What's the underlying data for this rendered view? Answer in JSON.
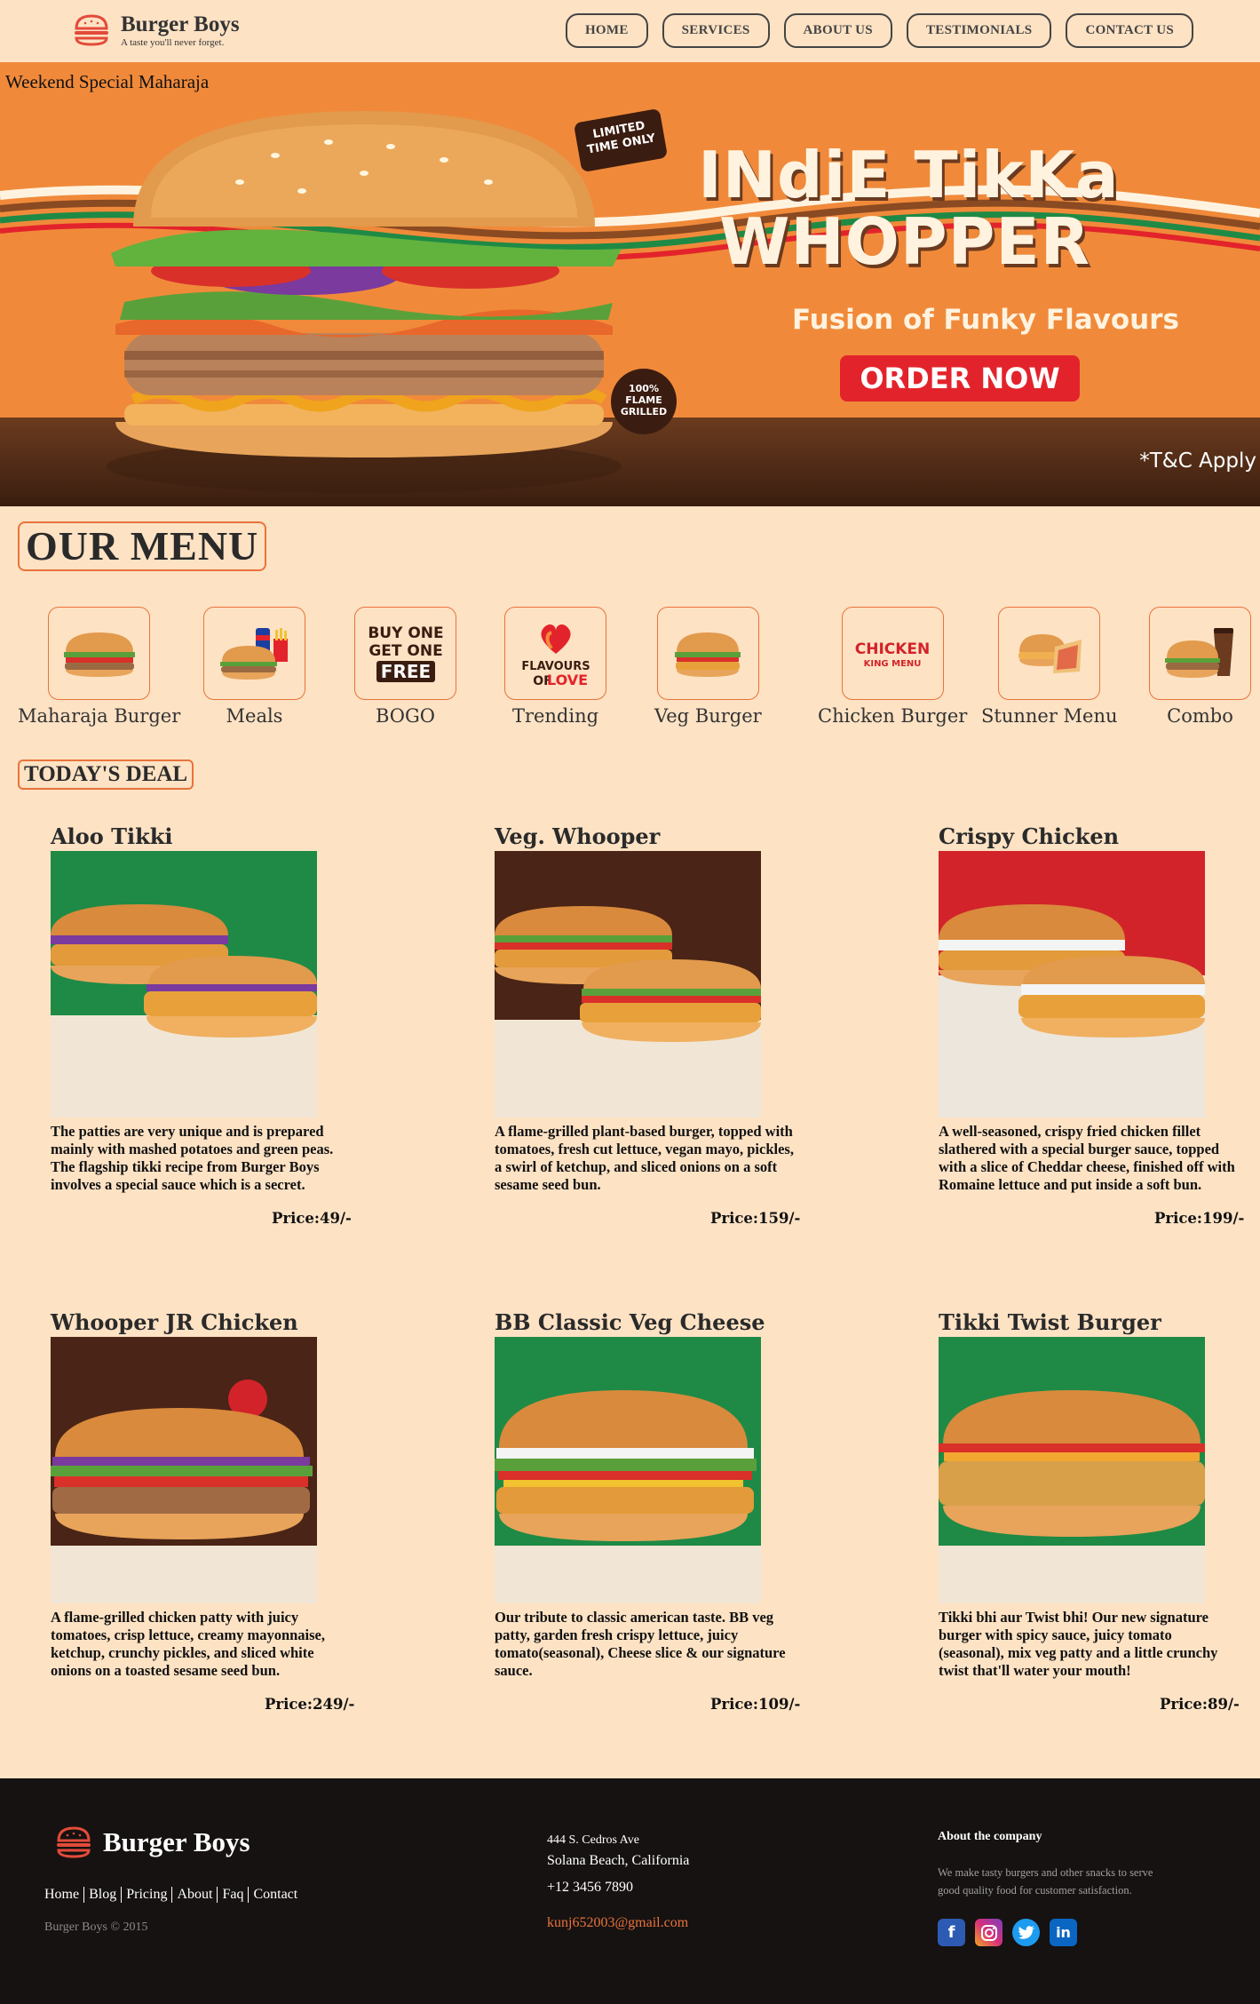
{
  "brand": {
    "name": "Burger Boys",
    "tagline": "A taste you'll never forget."
  },
  "nav": [
    "HOME",
    "SERVICES",
    "ABOUT US",
    "TESTIMONIALS",
    "CONTACT US"
  ],
  "hero": {
    "caption": "Weekend Special Maharaja",
    "limited": "LIMITED TIME ONLY",
    "title_line1": "INdiE TikKa",
    "title_line2": "WHOPPER",
    "subtitle": "Fusion of Funky Flavours",
    "cta": "ORDER NOW",
    "flame_badge": "100% FLAME GRILLED",
    "tc": "*T&C Apply"
  },
  "menu": {
    "title": "OUR MENU",
    "categories": [
      {
        "label": "Maharaja Burger",
        "icon": "burger-icon"
      },
      {
        "label": "Meals",
        "icon": "meal-icon"
      },
      {
        "label": "BOGO",
        "icon": "bogo-icon",
        "badge": "BUY ONE GET ONE FREE"
      },
      {
        "label": "Trending",
        "icon": "heart-icon",
        "badge": "FLAVOURS OF LOVE"
      },
      {
        "label": "Veg Burger",
        "icon": "burger-icon"
      },
      {
        "label": "Chicken Burger",
        "icon": "chicken-king-icon",
        "badge": "CHICKEN KING MENU"
      },
      {
        "label": "Stunner Menu",
        "icon": "wrap-icon"
      },
      {
        "label": "Combo",
        "icon": "combo-icon"
      }
    ]
  },
  "deals": {
    "title": "TODAY'S DEAL",
    "items": [
      {
        "name": "Aloo Tikki",
        "desc": "The patties are very unique and is prepared mainly with mashed potatoes and green peas. The flagship tikki recipe from Burger Boys involves a special sauce which is a secret.",
        "price": "Price:49/-",
        "bg": "#1e8a46",
        "style": "double"
      },
      {
        "name": "Veg. Whooper",
        "desc": "A flame-grilled plant-based burger, topped with tomatoes, fresh cut lettuce, vegan mayo, pickles, a swirl of ketchup, and sliced onions on a soft sesame seed bun.",
        "price": "Price:159/-",
        "bg": "#4a2416",
        "style": "double"
      },
      {
        "name": "Crispy Chicken",
        "desc": "A well-seasoned, crispy fried chicken fillet slathered with a special burger sauce, topped with a slice of Cheddar cheese, finished off with Romaine lettuce and put inside a soft bun.",
        "price": "Price:199/-",
        "bg": "#d2232a",
        "style": "double"
      },
      {
        "name": "Whooper JR Chicken",
        "desc": "A flame-grilled chicken patty with juicy tomatoes, crisp lettuce, creamy mayonnaise, ketchup, crunchy pickles, and sliced white onions on a toasted sesame seed bun.",
        "price": "Price:249/-",
        "bg": "#4a2416",
        "style": "single"
      },
      {
        "name": "BB Classic Veg Cheese",
        "desc": "Our tribute to classic american taste. BB veg patty, garden fresh crispy lettuce, juicy tomato(seasonal), Cheese slice & our signature sauce.",
        "price": "Price:109/-",
        "bg": "#1e8a46",
        "style": "single"
      },
      {
        "name": "Tikki Twist Burger",
        "desc": "Tikki bhi aur Twist bhi! Our new signature burger with spicy sauce, juicy tomato (seasonal), mix veg patty and a little crunchy twist that'll water your mouth!",
        "price": "Price:89/-",
        "bg": "#1e8a46",
        "style": "single"
      }
    ]
  },
  "footer": {
    "brand": "Burger Boys",
    "links": [
      "Home",
      "Blog",
      "Pricing",
      "About",
      "Faq",
      "Contact"
    ],
    "copyright": "Burger Boys © 2015",
    "address1": "444 S. Cedros Ave",
    "address2": "Solana Beach, California",
    "phone": "+12 3456 7890",
    "email": "kunj652003@gmail.com",
    "about_heading": "About the company",
    "about_text": "We make tasty burgers and other snacks to serve good quality food for customer satisfaction.",
    "social": [
      {
        "name": "facebook-icon",
        "color": "#2d5bb3",
        "glyph": "f"
      },
      {
        "name": "instagram-icon",
        "color": "#d6307a",
        "glyph": "◎"
      },
      {
        "name": "twitter-icon",
        "color": "#1d9bf0",
        "glyph": "🐦"
      },
      {
        "name": "linkedin-icon",
        "color": "#0a66c2",
        "glyph": "in"
      }
    ]
  }
}
